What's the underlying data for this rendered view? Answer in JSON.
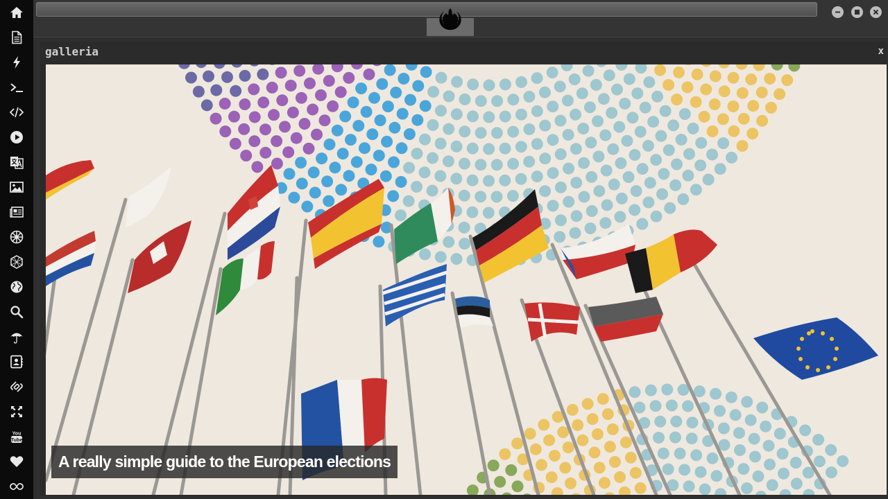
{
  "sidebar": {
    "items": [
      {
        "icon": "home-icon"
      },
      {
        "icon": "document-icon"
      },
      {
        "icon": "bolt-icon"
      },
      {
        "icon": "terminal-icon"
      },
      {
        "icon": "code-icon"
      },
      {
        "icon": "play-icon"
      },
      {
        "icon": "translate-icon"
      },
      {
        "icon": "image-icon"
      },
      {
        "icon": "newspaper-icon"
      },
      {
        "icon": "galactic-empire-icon"
      },
      {
        "icon": "hexagon-icon"
      },
      {
        "icon": "globe-icon"
      },
      {
        "icon": "search-icon"
      },
      {
        "icon": "umbrella-icon"
      },
      {
        "icon": "contact-card-icon"
      },
      {
        "icon": "link-icon"
      },
      {
        "icon": "expand-icon"
      },
      {
        "icon": "youtube-icon"
      },
      {
        "icon": "heart-icon"
      },
      {
        "icon": "infinity-icon"
      }
    ]
  },
  "header": {
    "logo": "rebel-alliance-icon"
  },
  "window_controls": [
    "minimize-icon",
    "maximize-icon",
    "close-icon"
  ],
  "panel": {
    "title": "galleria",
    "close_label": "x",
    "image_caption": "A really simple guide to the European elections"
  },
  "colors": {
    "sidebar_bg": "#0b0b0b",
    "panel_bg": "#2b2b2b",
    "image_bg": "#efe8de"
  }
}
